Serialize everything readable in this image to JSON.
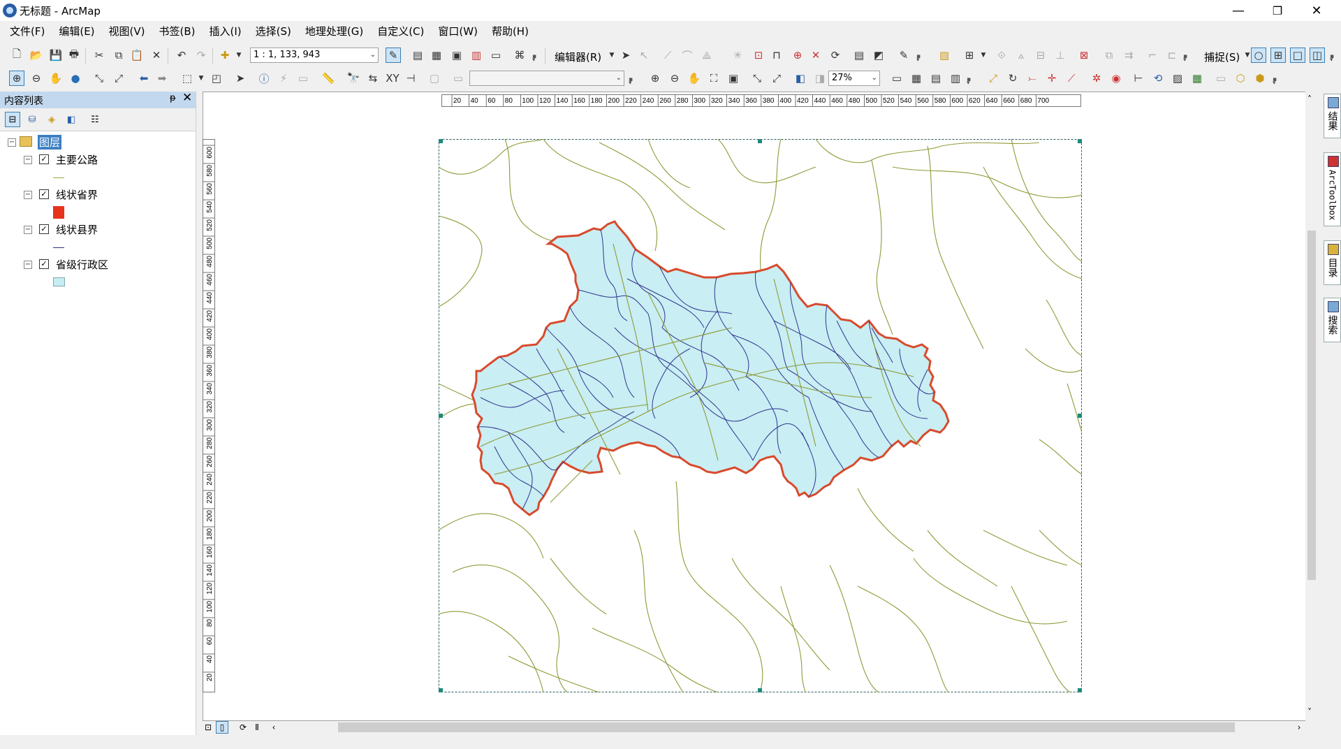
{
  "window": {
    "title": "无标题 - ArcMap",
    "minimize": "—",
    "maximize": "❐",
    "close": "✕"
  },
  "menu": [
    "文件(F)",
    "编辑(E)",
    "视图(V)",
    "书签(B)",
    "插入(I)",
    "选择(S)",
    "地理处理(G)",
    "自定义(C)",
    "窗口(W)",
    "帮助(H)"
  ],
  "toolbar1": {
    "scale": "1 : 1, 133, 943",
    "editor_label": "编辑器(R)",
    "snapping_label": "捕捉(S)"
  },
  "toolbar2": {
    "zoom_percent": "27%"
  },
  "toc": {
    "title": "内容列表",
    "pin": "ᵽ",
    "close": "✕",
    "root_layer": "图层",
    "layers": [
      {
        "name": "主要公路",
        "checked": true,
        "symbol": "line",
        "color": "#9aa63c"
      },
      {
        "name": "线状省界",
        "checked": true,
        "symbol": "fill",
        "color": "#e8331c"
      },
      {
        "name": "线状县界",
        "checked": true,
        "symbol": "line",
        "color": "#2b2f8c"
      },
      {
        "name": "省级行政区",
        "checked": true,
        "symbol": "fill",
        "color": "#c6eef2"
      }
    ]
  },
  "ruler": {
    "top_ticks": [
      "20",
      "40",
      "60",
      "80",
      "100",
      "120",
      "140",
      "160",
      "180",
      "200",
      "220",
      "240",
      "260",
      "280",
      "300",
      "320",
      "340",
      "360",
      "380",
      "400",
      "420",
      "440",
      "460",
      "480",
      "500",
      "520",
      "540",
      "560",
      "580",
      "600",
      "620",
      "640",
      "660",
      "680",
      "700"
    ],
    "left_ticks": [
      "600",
      "580",
      "560",
      "540",
      "520",
      "500",
      "480",
      "460",
      "440",
      "420",
      "400",
      "380",
      "360",
      "340",
      "320",
      "300",
      "280",
      "260",
      "240",
      "220",
      "200",
      "180",
      "160",
      "140",
      "120",
      "100",
      "80",
      "60",
      "40",
      "20"
    ]
  },
  "map": {
    "province_fill": "#c9eef3",
    "province_border": "#d84a2c",
    "county_line": "#2f3590",
    "road_line": "#8e9a37"
  },
  "dock_tabs": [
    "结果",
    "ArcToolbox",
    "目录",
    "搜索"
  ],
  "icons": {
    "scroll_left": "‹",
    "scroll_right": "›",
    "scroll_up": "˄",
    "scroll_down": "˅"
  }
}
